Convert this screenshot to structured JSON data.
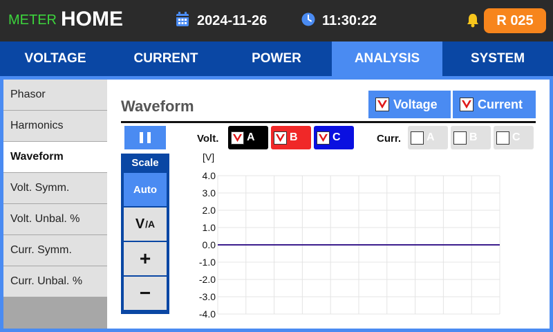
{
  "header": {
    "brand_prefix": "METER",
    "screen_title": "HOME",
    "date": "2024-11-26",
    "time": "11:30:22",
    "record_label": "R 025"
  },
  "tabs": [
    {
      "label": "VOLTAGE",
      "active": false
    },
    {
      "label": "CURRENT",
      "active": false
    },
    {
      "label": "POWER",
      "active": false
    },
    {
      "label": "ANALYSIS",
      "active": true
    },
    {
      "label": "SYSTEM",
      "active": false
    }
  ],
  "sidebar": {
    "items": [
      {
        "label": "Phasor",
        "active": false
      },
      {
        "label": "Harmonics",
        "active": false
      },
      {
        "label": "Waveform",
        "active": true
      },
      {
        "label": "Volt. Symm.",
        "active": false
      },
      {
        "label": "Volt. Unbal. %",
        "active": false
      },
      {
        "label": "Curr. Symm.",
        "active": false
      },
      {
        "label": "Curr. Unbal. %",
        "active": false
      }
    ]
  },
  "panel": {
    "title": "Waveform",
    "voltage_toggle": {
      "label": "Voltage",
      "checked": true
    },
    "current_toggle": {
      "label": "Current",
      "checked": true
    },
    "volt_label": "Volt.",
    "curr_label": "Curr.",
    "volt_phases": [
      {
        "label": "A",
        "checked": true,
        "color": "#000000"
      },
      {
        "label": "B",
        "checked": true,
        "color": "#f02828"
      },
      {
        "label": "C",
        "checked": true,
        "color": "#0a10e0"
      }
    ],
    "curr_phases": [
      {
        "label": "A",
        "checked": false
      },
      {
        "label": "B",
        "checked": false
      },
      {
        "label": "C",
        "checked": false
      }
    ],
    "scale": {
      "label": "Scale",
      "auto_label": "Auto",
      "va_main": "V",
      "va_sub": "/A",
      "plus_label": "+",
      "minus_label": "−"
    }
  },
  "colors": {
    "header_bg": "#2b2b2b",
    "brand_green": "#3cd43c",
    "tab_bg": "#0a47a4",
    "accent_blue": "#4a8bf2",
    "record_orange": "#f7851c",
    "bell_yellow": "#f7c51c",
    "check_red": "#e01818",
    "trace_color": "#3a1c8c"
  },
  "chart_data": {
    "type": "line",
    "ylabel": "[V]",
    "ylim": [
      -4.0,
      4.0
    ],
    "yticks": [
      "4.0",
      "3.0",
      "2.0",
      "1.0",
      "0.0",
      "-1.0",
      "-2.0",
      "-3.0",
      "-4.0"
    ],
    "grid": true,
    "series": [
      {
        "values": [
          0,
          0,
          0,
          0,
          0,
          0,
          0,
          0,
          0,
          0,
          0
        ]
      }
    ]
  }
}
